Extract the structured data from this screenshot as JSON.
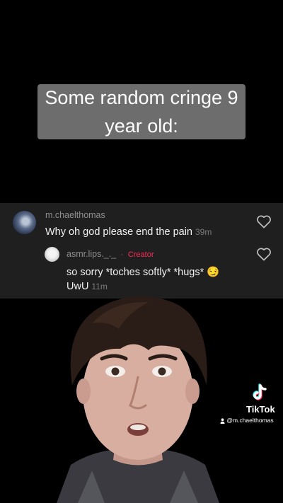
{
  "caption": {
    "line1": "Some random cringe 9",
    "line2": "year old:"
  },
  "comments": [
    {
      "username": "m.chaelthomas",
      "text": "Why oh god please end the pain",
      "time": "39m",
      "avatar_icon": "profile-photo",
      "like_icon": "heart-outline-icon"
    },
    {
      "username": "asmr.lips._._",
      "creator_separator": "·",
      "creator_label": "Creator",
      "text_line1": "so sorry *toches softly* *hugs* 😏",
      "text_line2": "UwU",
      "time": "11m",
      "avatar_icon": "profile-photo",
      "like_icon": "heart-outline-icon"
    }
  ],
  "watermark": {
    "brand": "TikTok",
    "handle": "@m.chaelthomas",
    "logo_icon": "tiktok-logo-icon",
    "user_icon": "user-icon"
  },
  "colors": {
    "background": "#000000",
    "caption_bg": "#808080",
    "comment_panel": "#1f1f1f",
    "creator_accent": "#fe2c55"
  }
}
